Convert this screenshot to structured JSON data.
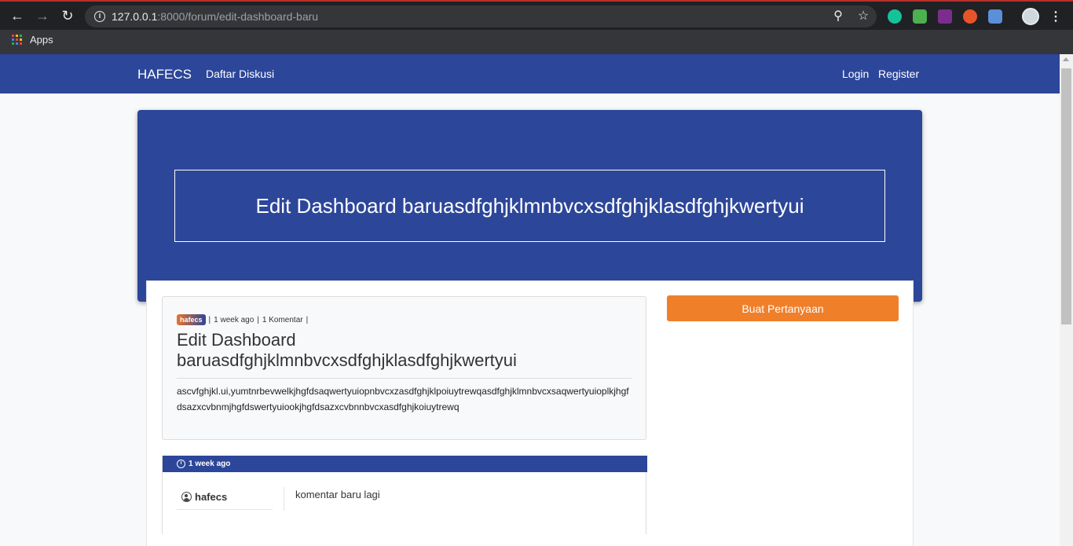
{
  "browser": {
    "url_host": "127.0.0.1",
    "url_rest": ":8000/forum/edit-dashboard-baru",
    "bookmarks_label": "Apps",
    "colors": {
      "accent_top": "#b7312c"
    }
  },
  "navbar": {
    "brand": "HAFECS",
    "links": {
      "discussions": "Daftar Diskusi",
      "login": "Login",
      "register": "Register"
    },
    "color": "#2c4699"
  },
  "hero": {
    "title": "Edit Dashboard baruasdfghjklmnbvcxsdfghjklasdfghjkwertyui"
  },
  "post": {
    "author": "hafecs",
    "time": "1 week ago",
    "comments": "1 Komentar",
    "title": "Edit Dashboard baruasdfghjklmnbvcxsdfghjklasdfghjkwertyui",
    "body": "ascvfghjkl.ui,yumtnrbevwelkjhgfdsaqwertyuiopnbvcxzasdfghjklpoiuytrewqasdfghjklmnbvcxsaqwertyuioplkjhgfdsazxcvbnmjhgfdswertyuiookjhgfdsazxcvbnnbvcxasdfghjkoiuytrewq"
  },
  "sidebar": {
    "ask_button": "Buat Pertanyaan",
    "button_color": "#f07f2a"
  },
  "comment": {
    "time": "1 week ago",
    "user": "hafecs",
    "text": "komentar baru lagi"
  }
}
